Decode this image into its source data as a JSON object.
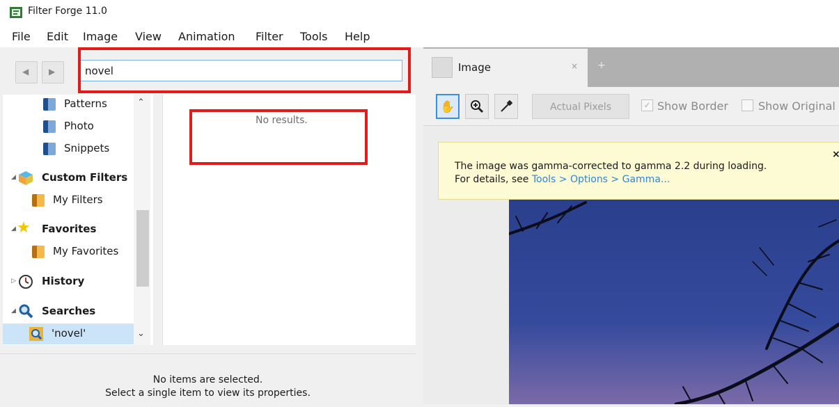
{
  "window": {
    "title": "Filter Forge 11.0"
  },
  "menu": [
    "File",
    "Edit",
    "Image",
    "View",
    "Animation",
    "Filter",
    "Tools",
    "Help"
  ],
  "search": {
    "value": "novel"
  },
  "tree": {
    "items": [
      {
        "label": "Patterns",
        "icon": "folder-icon"
      },
      {
        "label": "Photo",
        "icon": "folder-icon"
      },
      {
        "label": "Snippets",
        "icon": "folder-icon"
      },
      {
        "label": "Custom Filters",
        "icon": "cube-icon"
      },
      {
        "label": "My Filters",
        "icon": "folder-icon"
      },
      {
        "label": "Favorites",
        "icon": "star-icon"
      },
      {
        "label": "My Favorites",
        "icon": "folder-star-icon"
      },
      {
        "label": "History",
        "icon": "clock-icon"
      },
      {
        "label": "Searches",
        "icon": "magnifier-icon"
      },
      {
        "label": "'novel'",
        "icon": "saved-search-icon"
      }
    ]
  },
  "results": {
    "empty_text": "No results."
  },
  "properties": {
    "line1": "No items are selected.",
    "line2": "Select a single item to view its properties."
  },
  "tabs": [
    {
      "label": "Image",
      "close": "×",
      "add": "+"
    }
  ],
  "toolbar": {
    "actual_pixels": "Actual Pixels",
    "show_border": "Show Border",
    "show_original": "Show Original",
    "show_border_checked": true,
    "show_original_checked": false
  },
  "notice": {
    "line1": "The image was gamma-corrected to gamma 2.2 during loading.",
    "line2_prefix": "For details, see ",
    "line2_link": "Tools > Options > Gamma...",
    "close": "×"
  },
  "colors": {
    "highlight": "#e11a1a",
    "link": "#2f86d6",
    "notice_bg": "#fdfbd3",
    "selection": "#cce4f7"
  }
}
